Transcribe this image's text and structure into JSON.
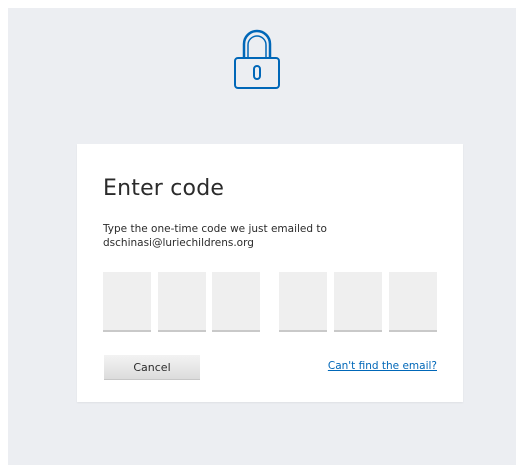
{
  "page": {
    "title": "Enter code",
    "description_line1": "Type the one-time code we just emailed to",
    "email": "dschinasi@luriechildrens.org"
  },
  "code_inputs": [
    "",
    "",
    "",
    "",
    "",
    ""
  ],
  "actions": {
    "cancel_label": "Cancel",
    "help_link_label": "Can't find the email?"
  },
  "icons": {
    "lock": "lock-icon"
  },
  "colors": {
    "accent": "#0067b8",
    "background": "#eceef2",
    "card": "#ffffff",
    "input_fill": "#efefef",
    "input_underline": "#c9c9c9"
  }
}
